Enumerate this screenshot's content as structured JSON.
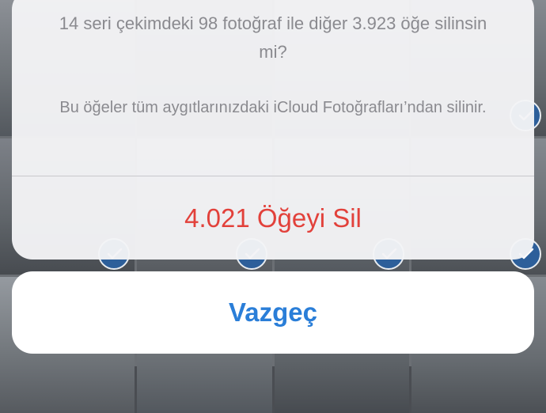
{
  "alert": {
    "title": "14 seri çekimdeki 98 fotoğraf ile diğer 3.923 öğe silinsin mi?",
    "message": "Bu öğeler tüm aygıtlarınızdaki iCloud Fotoğrafları’ndan silinir.",
    "delete_label": "4.021 Öğeyi Sil",
    "cancel_label": "Vazgeç"
  },
  "colors": {
    "destructive": "#e2413b",
    "cancel": "#2a7ed8",
    "message_text": "#8a8a8f"
  },
  "icons": {
    "selection": "checkmark-circle-icon"
  }
}
